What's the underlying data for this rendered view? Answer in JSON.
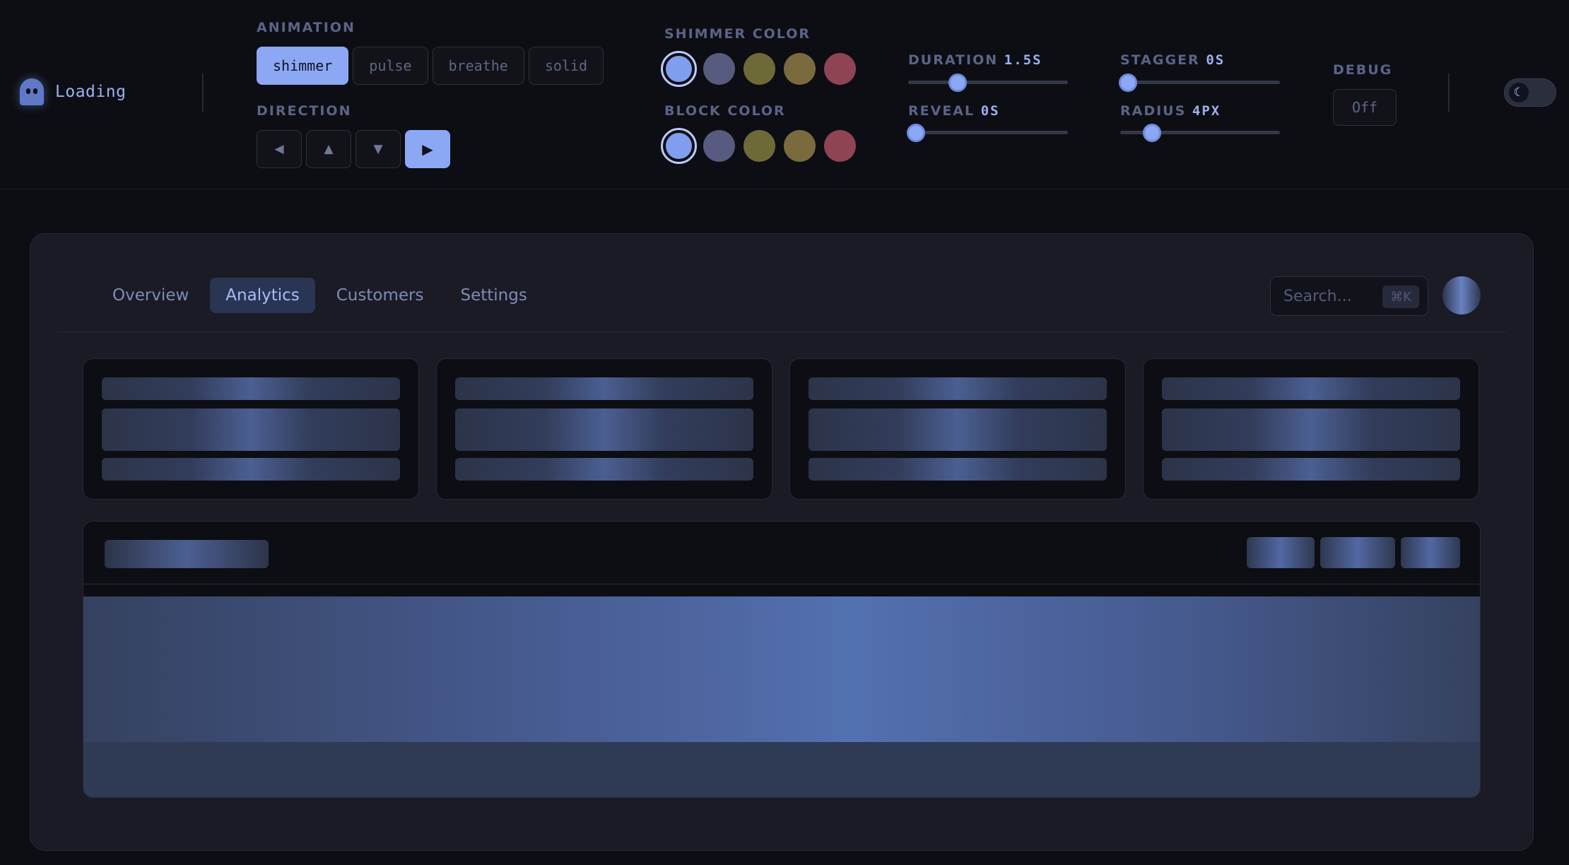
{
  "brand": {
    "title": "Loading",
    "icon": "ghost-icon"
  },
  "animation": {
    "label": "ANIMATION",
    "options": [
      "shimmer",
      "pulse",
      "breathe",
      "solid"
    ],
    "selected": "shimmer"
  },
  "direction": {
    "label": "DIRECTION",
    "options": [
      "◀",
      "▲",
      "▼",
      "▶"
    ],
    "selected": "▶"
  },
  "shimmer_color": {
    "label": "SHIMMER COLOR",
    "colors": [
      "#7f9ef0",
      "#575b80",
      "#6e6a38",
      "#7a6b3f",
      "#8f4453"
    ],
    "selected_index": 0
  },
  "block_color": {
    "label": "BLOCK COLOR",
    "colors": [
      "#7f9ef0",
      "#575b80",
      "#6e6a38",
      "#7a6b3f",
      "#8f4453"
    ],
    "selected_index": 0
  },
  "sliders": {
    "duration": {
      "label": "DURATION",
      "value": "1.5S",
      "fraction": 0.31
    },
    "stagger": {
      "label": "STAGGER",
      "value": "0S",
      "fraction": 0.05
    },
    "reveal": {
      "label": "REVEAL",
      "value": "0S",
      "fraction": 0.05
    },
    "radius": {
      "label": "RADIUS",
      "value": "4PX",
      "fraction": 0.2
    }
  },
  "debug": {
    "label": "DEBUG",
    "value": "Off"
  },
  "theme_toggle": {
    "icon": "moon-icon",
    "mode": "dark"
  },
  "card": {
    "tabs": [
      "Overview",
      "Analytics",
      "Customers",
      "Settings"
    ],
    "active_tab": "Analytics",
    "search": {
      "placeholder": "Search...",
      "shortcut": "⌘K"
    }
  },
  "colors": {
    "accent": "#8ca8f5",
    "background": "#0d0e13",
    "card": "#1a1b25"
  }
}
